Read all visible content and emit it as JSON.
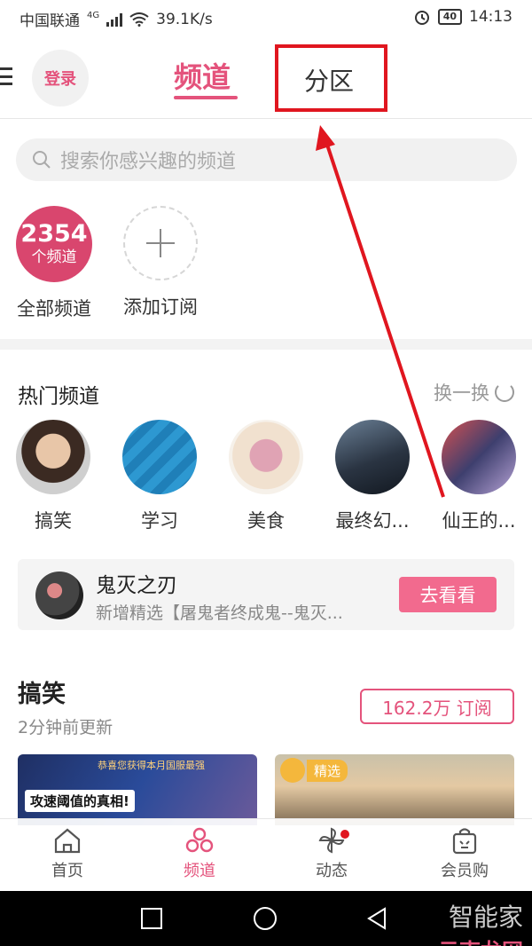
{
  "status_bar": {
    "carrier": "中国联通",
    "network": "4G",
    "speed": "39.1K/s",
    "battery": "40",
    "time": "14:13"
  },
  "header": {
    "login_label": "登录",
    "tab_channel": "频道",
    "tab_zone": "分区",
    "accent_color": "#e4537c",
    "highlight_color": "#e0161f"
  },
  "search": {
    "placeholder": "搜索你感兴趣的频道"
  },
  "quick": {
    "all_count": "2354",
    "all_unit": "个频道",
    "all_label": "全部频道",
    "add_label": "添加订阅"
  },
  "hot": {
    "title": "热门频道",
    "refresh_label": "换一换",
    "items": [
      {
        "label": "搞笑"
      },
      {
        "label": "学习"
      },
      {
        "label": "美食"
      },
      {
        "label": "最终幻..."
      },
      {
        "label": "仙王的..."
      }
    ]
  },
  "notice": {
    "title": "鬼灭之刃",
    "subtitle": "新增精选【屠鬼者终成鬼--鬼灭...",
    "button": "去看看"
  },
  "section": {
    "title": "搞笑",
    "subtitle": "2分钟前更新",
    "subscribe": "162.2万 订阅",
    "card1_top": "恭喜您获得本月国服最强",
    "card1_caption": "攻速阈值的真相!",
    "card2_tag": "精选"
  },
  "bottom_nav": {
    "home": "首页",
    "channel": "频道",
    "dynamic": "动态",
    "vip": "会员购"
  },
  "watermark": {
    "line1": "智能家",
    "line2": "云南龙网"
  }
}
